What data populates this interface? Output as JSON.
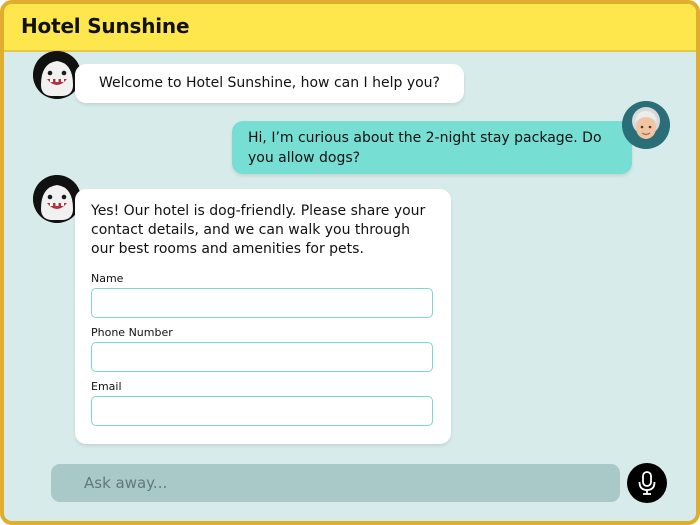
{
  "header": {
    "title": "Hotel Sunshine"
  },
  "messages": [
    {
      "sender": "bot",
      "text": "Welcome to Hotel Sunshine, how can I help you?"
    },
    {
      "sender": "user",
      "lines": [
        "Hi, I’m curious about the 2-night stay package. Do",
        "you allow dogs?"
      ]
    },
    {
      "sender": "bot",
      "lines": [
        "Yes! Our hotel is dog-friendly. Please share your",
        "contact details, and we can walk you through",
        "our best rooms and amenities for pets."
      ]
    }
  ],
  "form": {
    "fields": [
      {
        "label": "Name",
        "value": ""
      },
      {
        "label": "Phone Number",
        "value": ""
      },
      {
        "label": "Email",
        "value": ""
      }
    ]
  },
  "composer": {
    "placeholder": "Ask away..."
  },
  "icons": {
    "bot_avatar": "ghost-bot-icon",
    "user_avatar": "user-avatar-icon",
    "mic": "microphone-icon"
  },
  "colors": {
    "header": "#fde74c",
    "border": "#dfae2e",
    "chat_background": "#d7ecea",
    "user_bubble": "#76ded3",
    "input_border": "#7fd6cb",
    "composer": "#a8c9c8"
  }
}
